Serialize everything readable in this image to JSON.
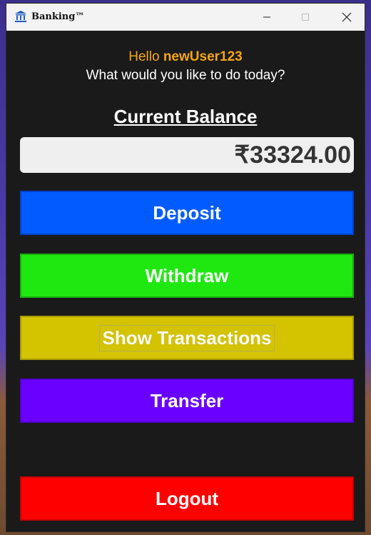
{
  "window": {
    "title": "Banking™"
  },
  "header": {
    "greeting_prefix": "Hello ",
    "username": "newUser123",
    "prompt": "What would you like to do today?"
  },
  "balance": {
    "title": "Current Balance",
    "amount": "₹33324.00"
  },
  "actions": {
    "deposit": "Deposit",
    "withdraw": "Withdraw",
    "transactions": "Show Transactions",
    "transfer": "Transfer",
    "logout": "Logout"
  },
  "colors": {
    "greeting": "#f5a516",
    "deposit": "#005cff",
    "withdraw": "#1fe810",
    "transactions": "#d4c400",
    "transfer": "#6a00ff",
    "logout": "#ff0000",
    "window_bg": "#1a1a1a"
  },
  "icons": {
    "app": "bank-icon",
    "minimize": "minimize-icon",
    "maximize": "maximize-icon",
    "close": "close-icon"
  }
}
